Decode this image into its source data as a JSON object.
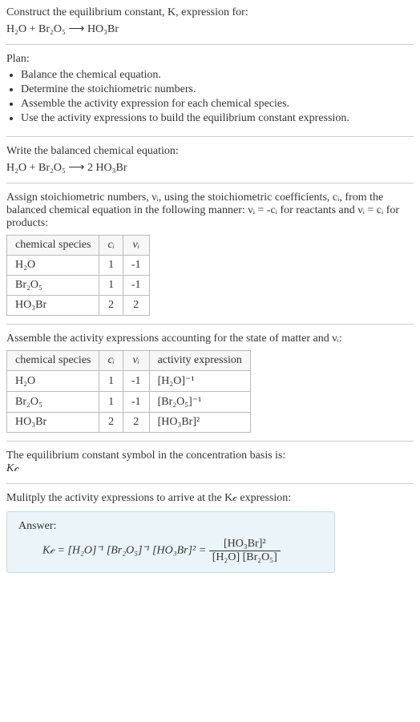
{
  "intro": {
    "line1": "Construct the equilibrium constant, K, expression for:",
    "equation": "H₂O + Br₂O₅ ⟶ HO₃Br"
  },
  "plan": {
    "heading": "Plan:",
    "items": [
      "Balance the chemical equation.",
      "Determine the stoichiometric numbers.",
      "Assemble the activity expression for each chemical species.",
      "Use the activity expressions to build the equilibrium constant expression."
    ]
  },
  "balanced": {
    "heading": "Write the balanced chemical equation:",
    "equation": "H₂O + Br₂O₅ ⟶ 2 HO₃Br"
  },
  "stoich": {
    "text": "Assign stoichiometric numbers, νᵢ, using the stoichiometric coefficients, cᵢ, from the balanced chemical equation in the following manner: νᵢ = -cᵢ for reactants and νᵢ = cᵢ for products:",
    "headers": {
      "species": "chemical species",
      "ci": "cᵢ",
      "vi": "νᵢ"
    },
    "rows": [
      {
        "species": "H₂O",
        "ci": "1",
        "vi": "-1"
      },
      {
        "species": "Br₂O₅",
        "ci": "1",
        "vi": "-1"
      },
      {
        "species": "HO₃Br",
        "ci": "2",
        "vi": "2"
      }
    ]
  },
  "activity": {
    "text": "Assemble the activity expressions accounting for the state of matter and νᵢ:",
    "headers": {
      "species": "chemical species",
      "ci": "cᵢ",
      "vi": "νᵢ",
      "expr": "activity expression"
    },
    "rows": [
      {
        "species": "H₂O",
        "ci": "1",
        "vi": "-1",
        "expr": "[H₂O]⁻¹"
      },
      {
        "species": "Br₂O₅",
        "ci": "1",
        "vi": "-1",
        "expr": "[Br₂O₅]⁻¹"
      },
      {
        "species": "HO₃Br",
        "ci": "2",
        "vi": "2",
        "expr": "[HO₃Br]²"
      }
    ]
  },
  "symbol": {
    "text": "The equilibrium constant symbol in the concentration basis is:",
    "value": "K𝒸"
  },
  "multiply": {
    "text": "Mulitply the activity expressions to arrive at the K𝒸 expression:"
  },
  "answer": {
    "label": "Answer:",
    "lhs": "K𝒸 = [H₂O]⁻¹ [Br₂O₅]⁻¹ [HO₃Br]² =",
    "num": "[HO₃Br]²",
    "den": "[H₂O] [Br₂O₅]"
  }
}
